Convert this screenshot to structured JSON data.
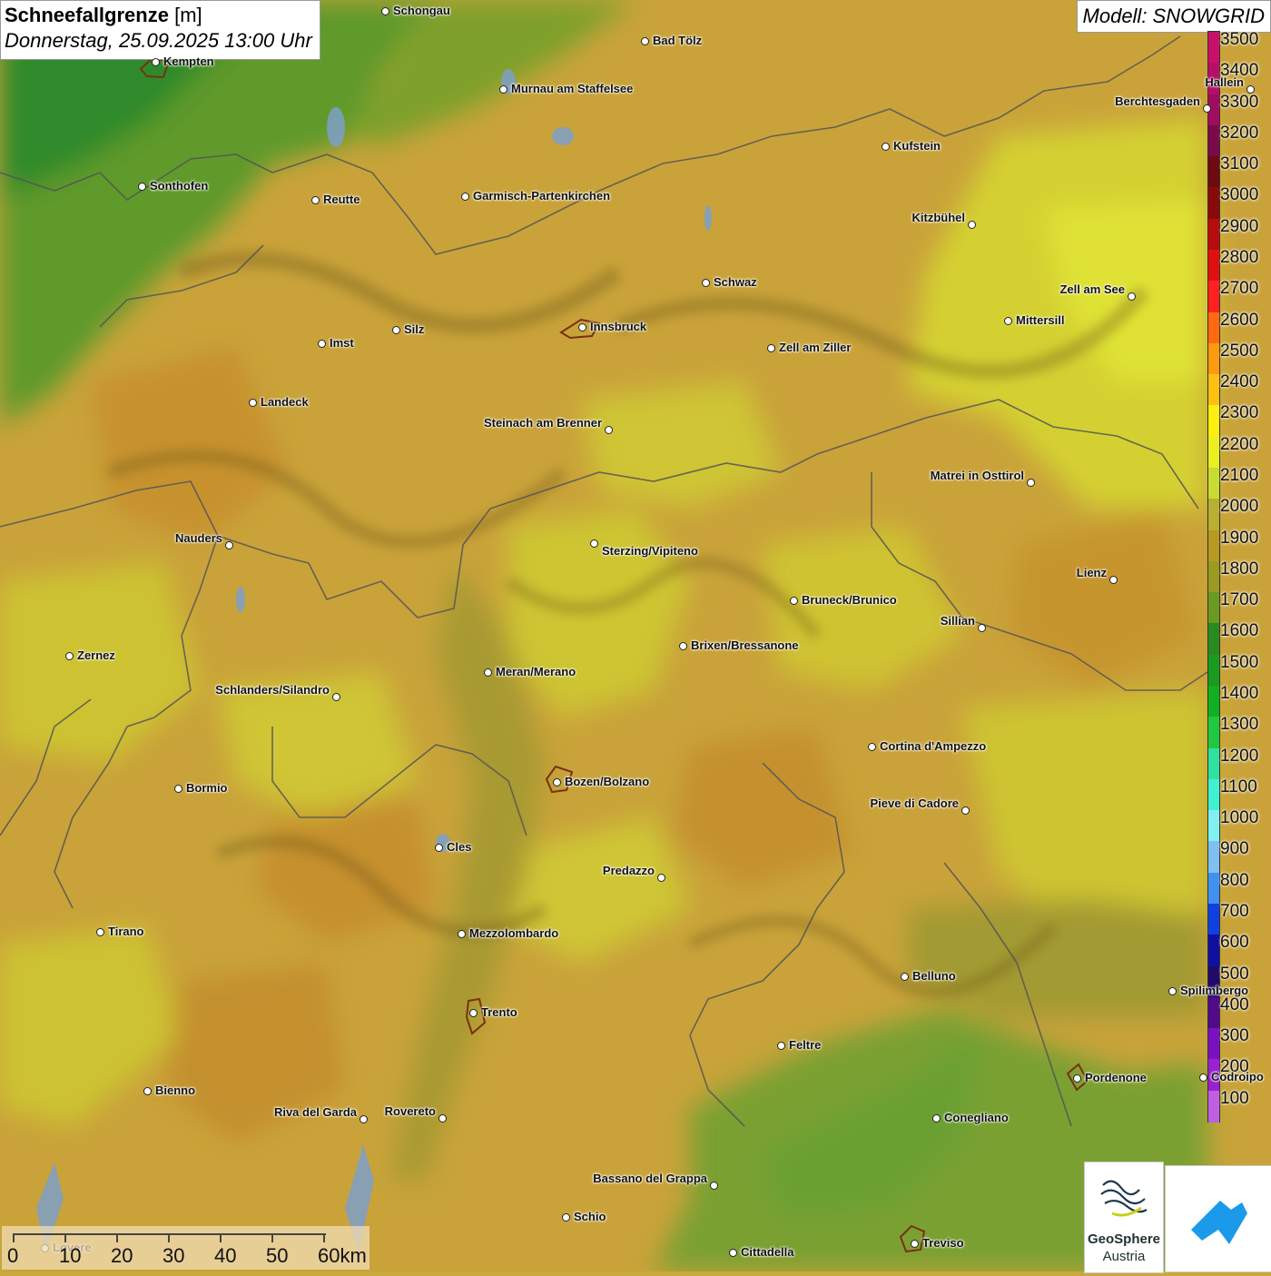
{
  "header": {
    "title_bold": "Schneefallgrenze",
    "title_unit": "[m]",
    "datetime": "Donnerstag, 25.09.2025 13:00 Uhr"
  },
  "model": {
    "label": "Modell: SNOWGRID"
  },
  "legend": {
    "labels": [
      "3500",
      "3400",
      "3300",
      "3200",
      "3100",
      "3000",
      "2900",
      "2800",
      "2700",
      "2600",
      "2500",
      "2400",
      "2300",
      "2200",
      "2100",
      "2000",
      "1900",
      "1800",
      "1700",
      "1600",
      "1500",
      "1400",
      "1300",
      "1200",
      "1100",
      "1000",
      "900",
      "800",
      "700",
      "600",
      "500",
      "400",
      "300",
      "200",
      "100"
    ],
    "colors": [
      "#c8106a",
      "#b80e66",
      "#a00c5e",
      "#7c0a4a",
      "#6e0a10",
      "#8a0a0a",
      "#b80c0c",
      "#e01010",
      "#ff2020",
      "#ff6a10",
      "#ff9a10",
      "#ffc010",
      "#ffee10",
      "#eaf020",
      "#c8dc30",
      "#b8b030",
      "#b89a20",
      "#9a9a20",
      "#6a9a20",
      "#2a8a20",
      "#1a9a20",
      "#10b020",
      "#20c840",
      "#30e0a0",
      "#40f0d0",
      "#80f0f0",
      "#80c0f0",
      "#4090f0",
      "#1040e0",
      "#1010a0",
      "#200a6a",
      "#500a8a",
      "#7a10c0",
      "#9a20d0",
      "#c060e0"
    ]
  },
  "cities": [
    {
      "name": "Schongau"
    },
    {
      "name": "Bad Tölz"
    },
    {
      "name": "Kempten"
    },
    {
      "name": "Murnau am Staffelsee"
    },
    {
      "name": "Hallein"
    },
    {
      "name": "Berchtesgaden"
    },
    {
      "name": "Kufstein"
    },
    {
      "name": "Sonthofen"
    },
    {
      "name": "Reutte"
    },
    {
      "name": "Garmisch-Partenkirchen"
    },
    {
      "name": "Kitzbühel"
    },
    {
      "name": "Schwaz"
    },
    {
      "name": "Zell am See"
    },
    {
      "name": "Mittersill"
    },
    {
      "name": "Innsbruck"
    },
    {
      "name": "Silz"
    },
    {
      "name": "Imst"
    },
    {
      "name": "Zell am Ziller"
    },
    {
      "name": "Landeck"
    },
    {
      "name": "Steinach am Brenner"
    },
    {
      "name": "Matrei in Osttirol"
    },
    {
      "name": "Nauders"
    },
    {
      "name": "Sterzing/Vipiteno"
    },
    {
      "name": "Lienz"
    },
    {
      "name": "Bruneck/Brunico"
    },
    {
      "name": "Sillian"
    },
    {
      "name": "Brixen/Bressanone"
    },
    {
      "name": "Zernez"
    },
    {
      "name": "Meran/Merano"
    },
    {
      "name": "Schlanders/Silandro"
    },
    {
      "name": "Cortina d'Ampezzo"
    },
    {
      "name": "Bozen/Bolzano"
    },
    {
      "name": "Bormio"
    },
    {
      "name": "Pieve di Cadore"
    },
    {
      "name": "Cles"
    },
    {
      "name": "Predazzo"
    },
    {
      "name": "Tirano"
    },
    {
      "name": "Mezzolombardo"
    },
    {
      "name": "Belluno"
    },
    {
      "name": "Spilimbergo"
    },
    {
      "name": "Trento"
    },
    {
      "name": "Feltre"
    },
    {
      "name": "Pordenone"
    },
    {
      "name": "Codroipo"
    },
    {
      "name": "Bienno"
    },
    {
      "name": "Riva del Garda"
    },
    {
      "name": "Rovereto"
    },
    {
      "name": "Conegliano"
    },
    {
      "name": "Bassano del Grappa"
    },
    {
      "name": "Schio"
    },
    {
      "name": "Treviso"
    },
    {
      "name": "Cittadella"
    },
    {
      "name": "Lovere"
    }
  ],
  "scale": {
    "labels": [
      "0",
      "10",
      "20",
      "30",
      "40",
      "50",
      "60km"
    ]
  },
  "logos": {
    "geosphere_name": "GeoSphere",
    "geosphere_sub": "Austria"
  }
}
